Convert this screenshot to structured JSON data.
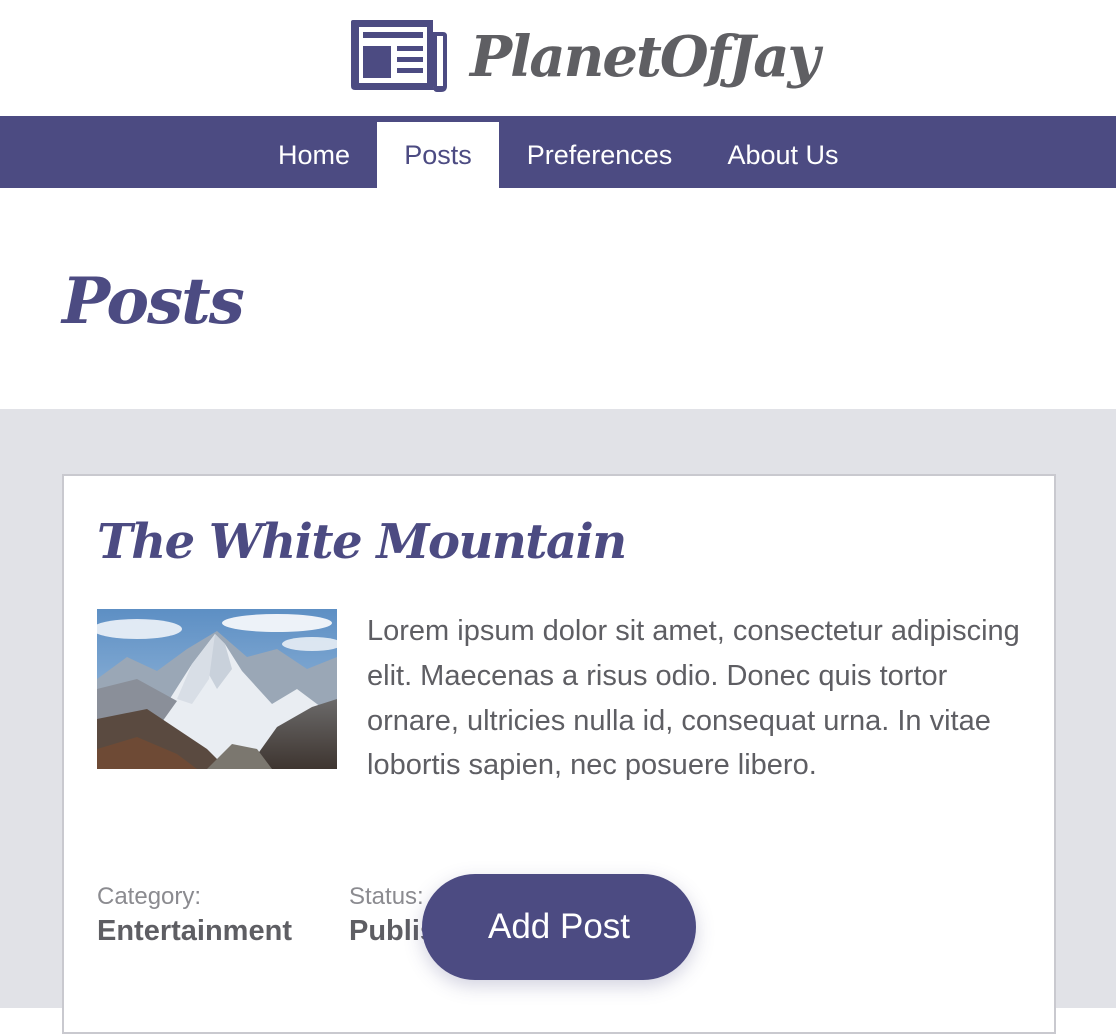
{
  "brand": {
    "name": "PlanetOfJay",
    "icon": "newspaper-icon"
  },
  "nav": {
    "items": [
      {
        "label": "Home",
        "active": false
      },
      {
        "label": "Posts",
        "active": true
      },
      {
        "label": "Preferences",
        "active": false
      },
      {
        "label": "About Us",
        "active": false
      }
    ]
  },
  "page": {
    "title": "Posts"
  },
  "post": {
    "title": "The White Mountain",
    "image": "mountain-photo",
    "body": "Lorem ipsum dolor sit amet, consectetur adipiscing elit. Maecenas a risus odio. Donec quis tortor ornare, ultricies nulla id, consequat urna. In vitae lobortis sapien, nec posuere libero.",
    "category_label": "Category:",
    "category_value": "Entertainment",
    "status_label": "Status:",
    "status_value": "Published"
  },
  "actions": {
    "add_post_label": "Add Post"
  },
  "colors": {
    "brand": "#4c4b82",
    "logo_text": "#5f5f63",
    "content_bg": "#e1e2e7",
    "body_text": "#5e5e63"
  }
}
